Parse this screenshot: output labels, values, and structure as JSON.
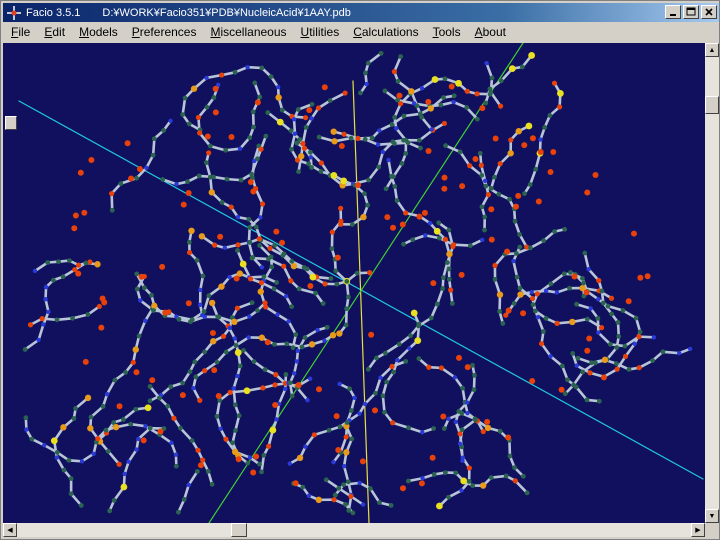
{
  "window": {
    "app_name": "Facio 3.5.1",
    "file_path": "D:¥WORK¥Facio351¥PDB¥NucleicAcid¥1AAY.pdb"
  },
  "menu": [
    {
      "label": "File"
    },
    {
      "label": "Edit"
    },
    {
      "label": "Models"
    },
    {
      "label": "Preferences"
    },
    {
      "label": "Miscellaneous"
    },
    {
      "label": "Utilities"
    },
    {
      "label": "Calculations"
    },
    {
      "label": "Tools"
    },
    {
      "label": "About"
    }
  ],
  "viewer": {
    "background_color": "#10105e",
    "atom_colors": {
      "carbon": "#2a6450",
      "oxygen": "#e8420a",
      "nitrogen": "#2a3ad8",
      "phosphorus": "#e89a1a",
      "sulfur": "#e8e020",
      "bond": "#b8c4d8"
    },
    "axis_colors": {
      "x": "#20c8e0",
      "y": "#e8e040",
      "z": "#40d030"
    }
  },
  "icons": {
    "app": "molecule-app-icon",
    "minimize": "minimize-icon",
    "maximize": "maximize-icon",
    "close": "close-icon"
  }
}
